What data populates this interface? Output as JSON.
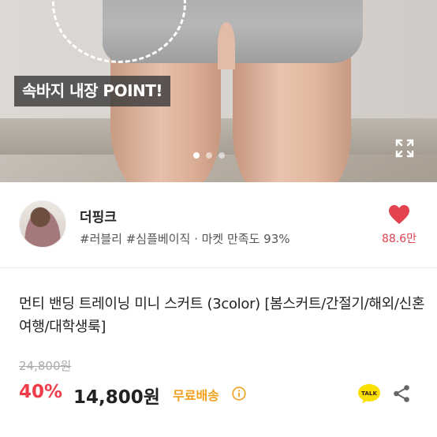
{
  "hero": {
    "point_label": "속바지 내장 POINT!",
    "slides_total": 3,
    "slide_active": 1,
    "expand_icon": "expand-icon"
  },
  "seller": {
    "name": "더핑크",
    "tags": "#러블리 #심플베이직 · 마켓 만족도 93%",
    "like_count": "88.6만",
    "like_color": "#e2434f"
  },
  "product": {
    "title": "먼티 밴딩 트레이닝 미니 스커트 (3color) [봄스커트/간절기/해외/신혼여행/대학생룩]",
    "original_price": "24,800원",
    "discount": "40%",
    "price": "14,800원",
    "shipping": "무료배송",
    "talk_label": "TALK"
  },
  "colors": {
    "discount": "#ef3b4a",
    "shipping": "#f0a01c",
    "kakao": "#f9e000"
  }
}
